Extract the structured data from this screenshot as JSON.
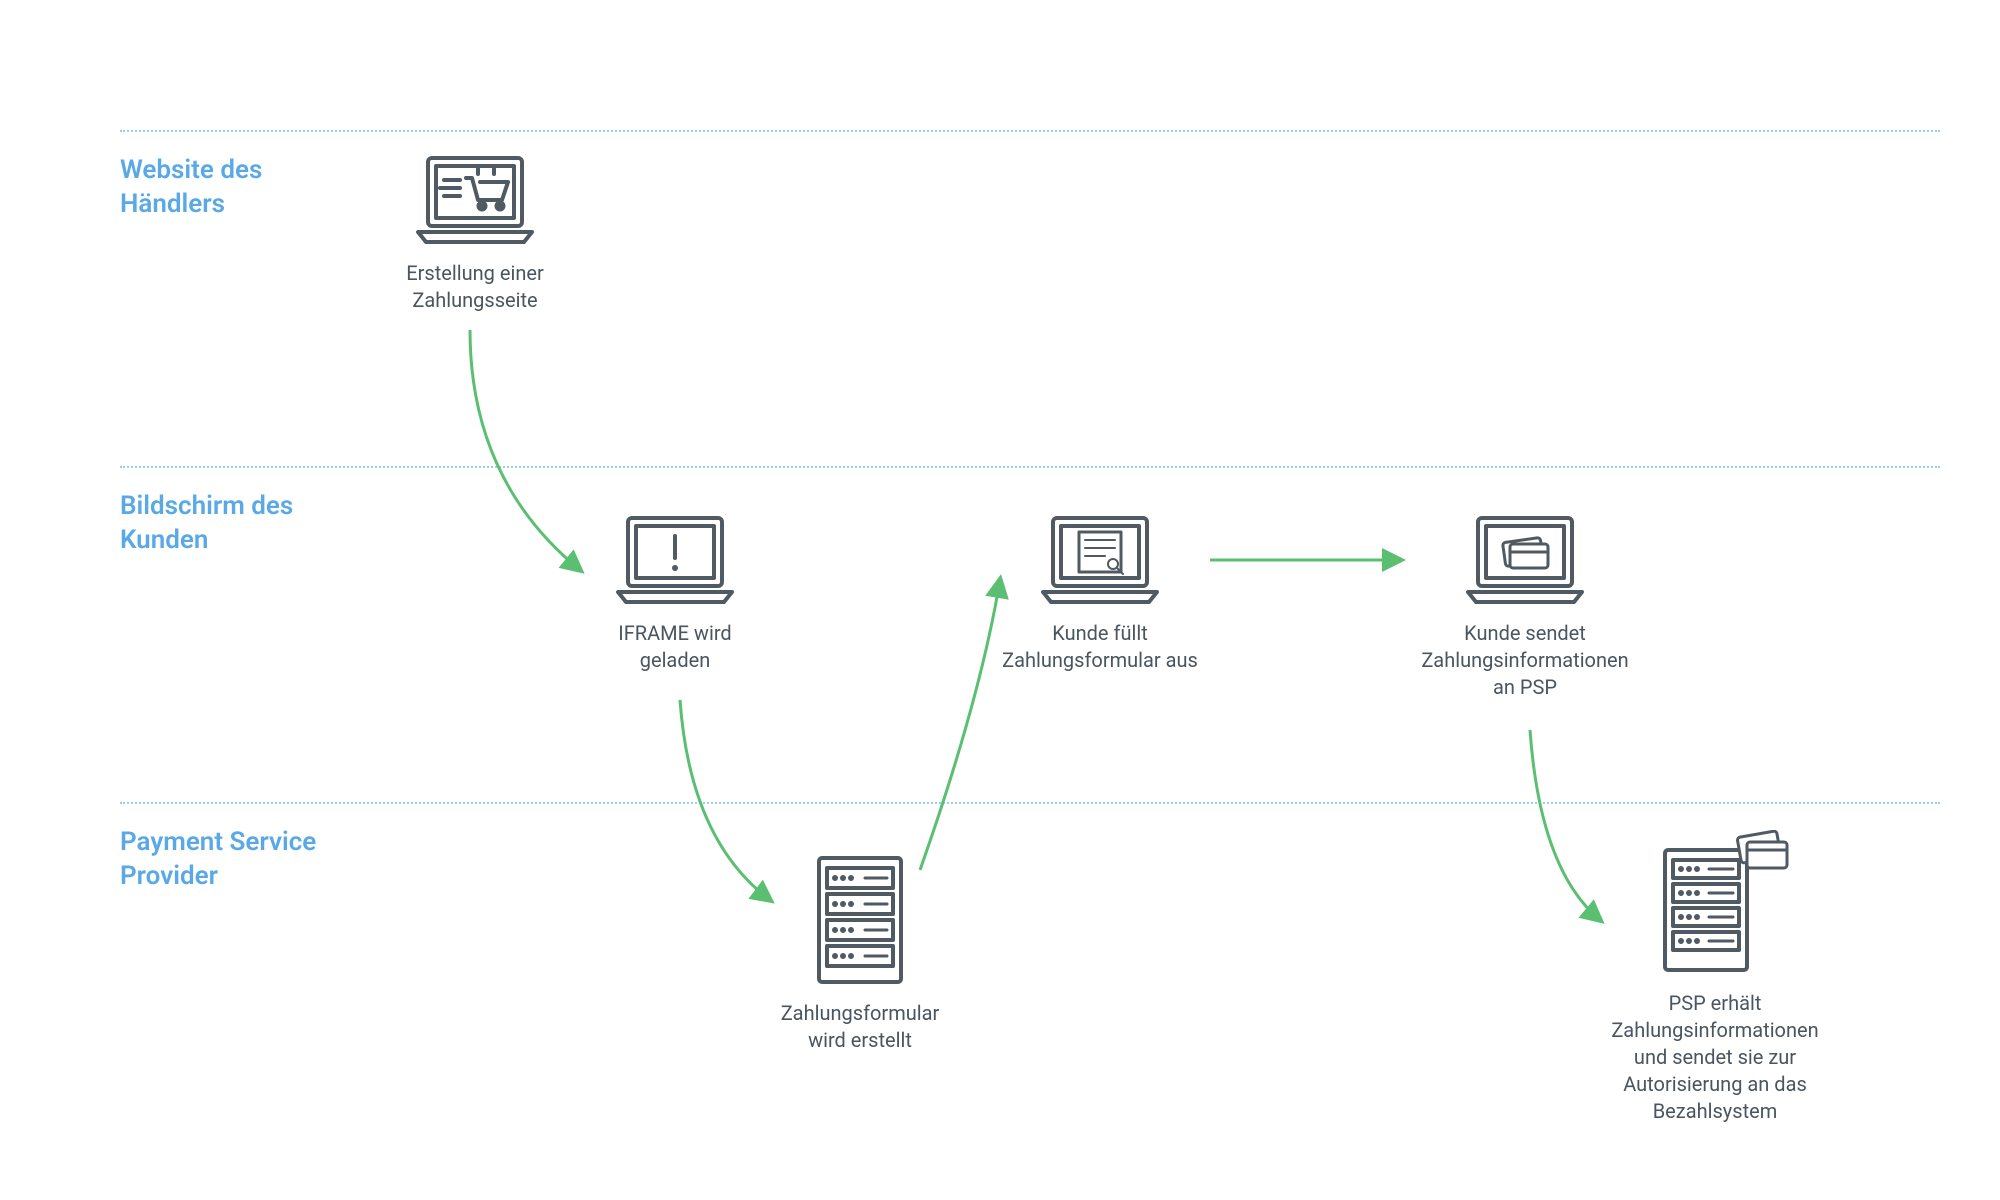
{
  "lanes": {
    "merchant": "Website des Händlers",
    "customer": "Bildschirm des Kunden",
    "psp": "Payment Service Provider"
  },
  "nodes": {
    "n1": "Erstellung einer Zahlungsseite",
    "n2": "IFRAME wird geladen",
    "n3": "Zahlungsformular wird erstellt",
    "n4": "Kunde füllt Zahlungsformular aus",
    "n5": "Kunde sendet Zahlungsinformationen an PSP",
    "n6": "PSP erhält Zahlungsinformationen und sendet sie zur Autorisierung an das Bezahlsystem"
  },
  "colors": {
    "laneLabel": "#5aa9e6",
    "dotted": "#9dcff0",
    "iconStroke": "#505a62",
    "arrow": "#5bbf72",
    "text": "#4a5560"
  }
}
